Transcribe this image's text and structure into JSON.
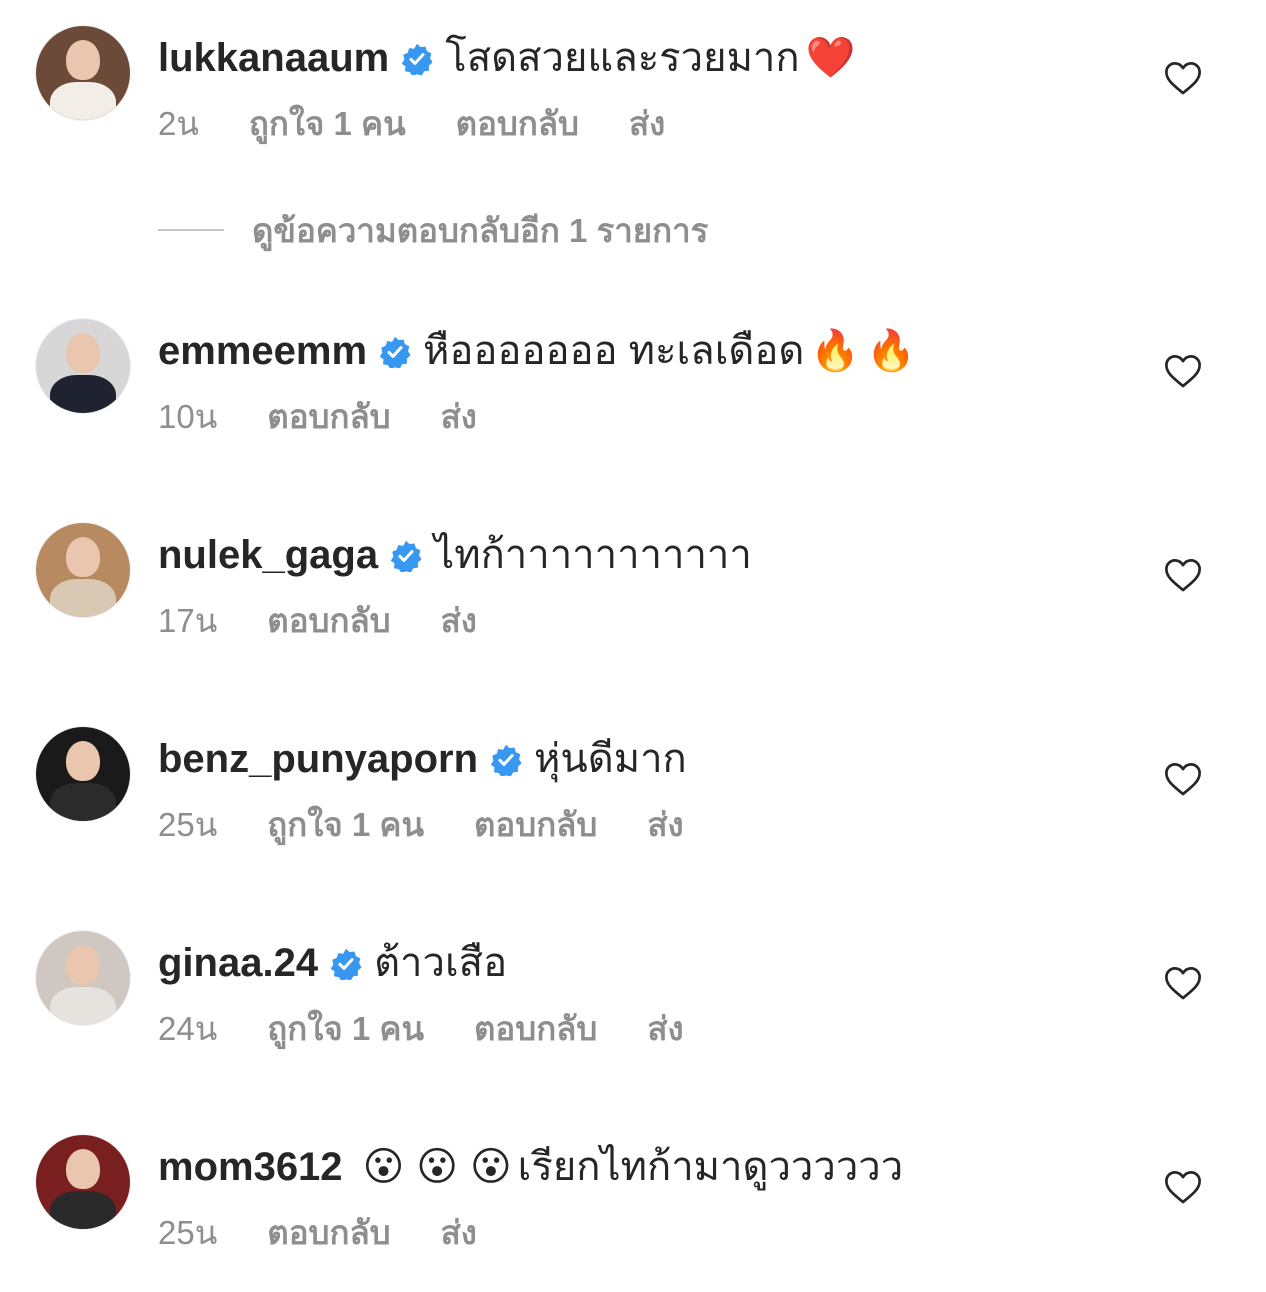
{
  "view_replies": "ดูข้อความตอบกลับอีก 1 รายการ",
  "reply_label": "ตอบกลับ",
  "send_label": "ส่ง",
  "comments": [
    {
      "username": "lukkanaaum",
      "verified": true,
      "text": "โสดสวยและรวยมาก",
      "emoji": [
        "❤️"
      ],
      "time": "2น",
      "likes": "ถูกใจ 1 คน",
      "avatar_colors": [
        "#6b4a3a",
        "#f2ede6"
      ]
    },
    {
      "username": "emmeemm",
      "verified": true,
      "text": "หือออออออ ทะเลเดือด",
      "emoji": [
        "🔥",
        "🔥"
      ],
      "time": "10น",
      "likes": "",
      "avatar_colors": [
        "#d7d7d7",
        "#1f2230"
      ]
    },
    {
      "username": "nulek_gaga",
      "verified": true,
      "text": "ไทก้าาาาาาาาาาา",
      "emoji": [],
      "time": "17น",
      "likes": "",
      "avatar_colors": [
        "#b88a62",
        "#d9c8b4"
      ]
    },
    {
      "username": "benz_punyaporn",
      "verified": true,
      "text": "หุ่นดีมาก",
      "emoji": [],
      "time": "25น",
      "likes": "ถูกใจ 1 คน",
      "avatar_colors": [
        "#1a1a1a",
        "#2b2b2b"
      ]
    },
    {
      "username": "ginaa.24",
      "verified": true,
      "text": "ต้าวเสือ",
      "emoji": [],
      "time": "24น",
      "likes": "ถูกใจ 1 คน",
      "avatar_colors": [
        "#cfc8c2",
        "#e6e2de"
      ]
    },
    {
      "username": "mom3612",
      "verified": false,
      "text": "เรียกไทก้ามาดูวววววว",
      "emoji_before": [
        "😮",
        "😮",
        "😮"
      ],
      "emoji": [],
      "time": "25น",
      "likes": "",
      "avatar_colors": [
        "#7a1f1f",
        "#2a2a2a"
      ]
    }
  ],
  "colors": {
    "text_primary": "#262626",
    "text_secondary": "#8e8e8e",
    "verified_blue": "#3897f0",
    "heart_stroke": "#262626"
  },
  "icons": {
    "verified": "verified-badge-icon",
    "like": "heart-outline-icon"
  }
}
